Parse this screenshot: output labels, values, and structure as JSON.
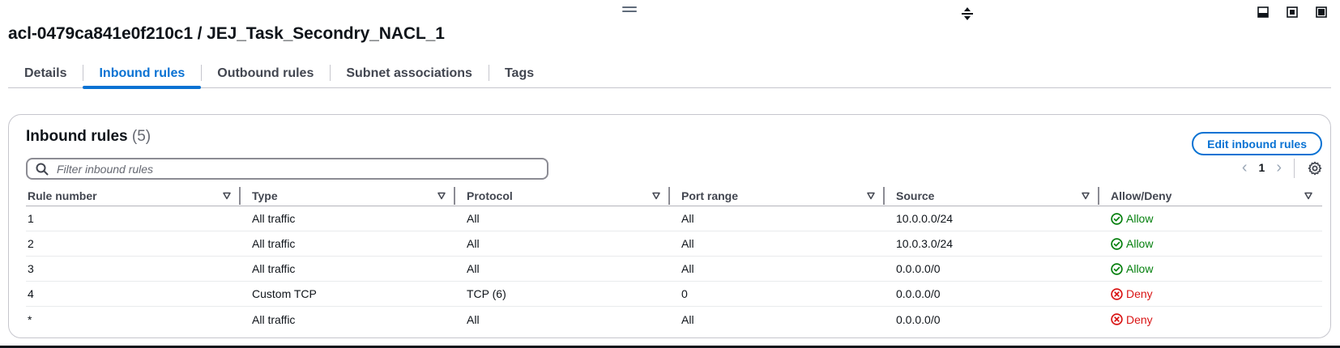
{
  "header": {
    "title": "acl-0479ca841e0f210c1 / JEJ_Task_Secondry_NACL_1"
  },
  "tabs": [
    {
      "label": "Details"
    },
    {
      "label": "Inbound rules"
    },
    {
      "label": "Outbound rules"
    },
    {
      "label": "Subnet associations"
    },
    {
      "label": "Tags"
    }
  ],
  "active_tab": "Inbound rules",
  "container": {
    "title": "Inbound rules",
    "count": "(5)",
    "edit_button": "Edit inbound rules",
    "filter_placeholder": "Filter inbound rules",
    "page": "1"
  },
  "table": {
    "columns": [
      "Rule number",
      "Type",
      "Protocol",
      "Port range",
      "Source",
      "Allow/Deny"
    ],
    "rows": [
      {
        "rule": "1",
        "type": "All traffic",
        "protocol": "All",
        "port": "All",
        "source": "10.0.0.0/24",
        "action": "Allow"
      },
      {
        "rule": "2",
        "type": "All traffic",
        "protocol": "All",
        "port": "All",
        "source": "10.0.3.0/24",
        "action": "Allow"
      },
      {
        "rule": "3",
        "type": "All traffic",
        "protocol": "All",
        "port": "All",
        "source": "0.0.0.0/0",
        "action": "Allow"
      },
      {
        "rule": "4",
        "type": "Custom TCP",
        "protocol": "TCP (6)",
        "port": "0",
        "source": "0.0.0.0/0",
        "action": "Deny"
      },
      {
        "rule": "*",
        "type": "All traffic",
        "protocol": "All",
        "port": "All",
        "source": "0.0.0.0/0",
        "action": "Deny"
      }
    ]
  },
  "icons": {
    "drag": "drag-handle-icon",
    "resize": "resize-vertical-icon",
    "panel_bottom": "panel-bottom-icon",
    "panel_full": "panel-maximize-icon",
    "panel_side": "panel-side-icon",
    "search": "search-icon",
    "prev": "chevron-left-icon",
    "next": "chevron-right-icon",
    "settings": "gear-icon",
    "sort": "sort-caret-down-icon",
    "allow": "check-circle-icon",
    "deny": "x-circle-icon"
  },
  "colors": {
    "accent": "#0972d3",
    "allow": "#037f0c",
    "deny": "#d91515"
  }
}
